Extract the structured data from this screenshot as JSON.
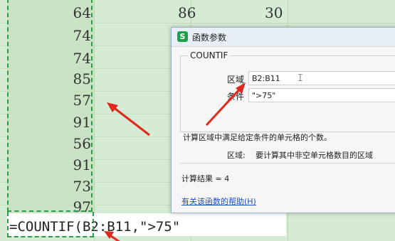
{
  "sheet": {
    "top_row_values": [
      "64",
      "86",
      "30"
    ],
    "column_values": [
      "74",
      "74",
      "85",
      "57",
      "91",
      "56",
      "91",
      "73",
      "97"
    ],
    "formula_text": "=COUNTIF(B2:B11,\">75\""
  },
  "dialog": {
    "title": "函数参数",
    "app_icon_letter": "S",
    "function_name": "COUNTIF",
    "fields": [
      {
        "label": "区域",
        "value": "B2:B11"
      },
      {
        "label": "条件",
        "value": "\">75\""
      }
    ],
    "description": "计算区域中满足给定条件的单元格的个数。",
    "param_name": "区域:",
    "param_description": "要计算其中非空单元格数目的区域",
    "result_label": "计算结果 =",
    "result_value": "4",
    "help_link": "有关该函数的帮助(H)"
  },
  "colors": {
    "sheet_bg": "#d6ebd3",
    "selection_border": "#2e9b49",
    "arrow": "#e0281e",
    "link": "#1a4fcf"
  }
}
